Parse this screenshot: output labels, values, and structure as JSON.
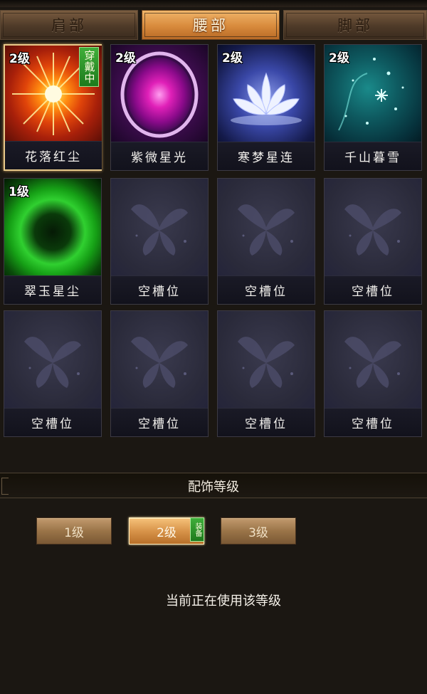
{
  "tabs": [
    {
      "label": "肩部",
      "active": false
    },
    {
      "label": "腰部",
      "active": true
    },
    {
      "label": "脚部",
      "active": false
    }
  ],
  "slots": [
    {
      "name": "花落红尘",
      "level": "2级",
      "badge": "穿戴中",
      "art": "red-star-burst"
    },
    {
      "name": "紫微星光",
      "level": "2级",
      "badge": "",
      "art": "purple-orb"
    },
    {
      "name": "寒梦星连",
      "level": "2级",
      "badge": "",
      "art": "white-lotus"
    },
    {
      "name": "千山暮雪",
      "level": "2级",
      "badge": "",
      "art": "teal-snowflakes"
    },
    {
      "name": "翠玉星尘",
      "level": "1级",
      "badge": "",
      "art": "green-ring"
    },
    {
      "name": "空槽位",
      "level": "",
      "badge": "",
      "art": "butterfly-placeholder"
    },
    {
      "name": "空槽位",
      "level": "",
      "badge": "",
      "art": "butterfly-placeholder"
    },
    {
      "name": "空槽位",
      "level": "",
      "badge": "",
      "art": "butterfly-placeholder"
    },
    {
      "name": "空槽位",
      "level": "",
      "badge": "",
      "art": "butterfly-placeholder"
    },
    {
      "name": "空槽位",
      "level": "",
      "badge": "",
      "art": "butterfly-placeholder"
    },
    {
      "name": "空槽位",
      "level": "",
      "badge": "",
      "art": "butterfly-placeholder"
    },
    {
      "name": "空槽位",
      "level": "",
      "badge": "",
      "art": "butterfly-placeholder"
    }
  ],
  "section": {
    "title": "配饰等级"
  },
  "levels": [
    {
      "label": "1级",
      "active": false
    },
    {
      "label": "2级",
      "active": true
    },
    {
      "label": "3级",
      "active": false
    }
  ],
  "equip_tag": "装备",
  "status_text": "当前正在使用该等级",
  "colors": {
    "accent": "#d88a3c",
    "equipped_badge": "#2e9a2a",
    "empty_slot": "#2a2a3a"
  }
}
